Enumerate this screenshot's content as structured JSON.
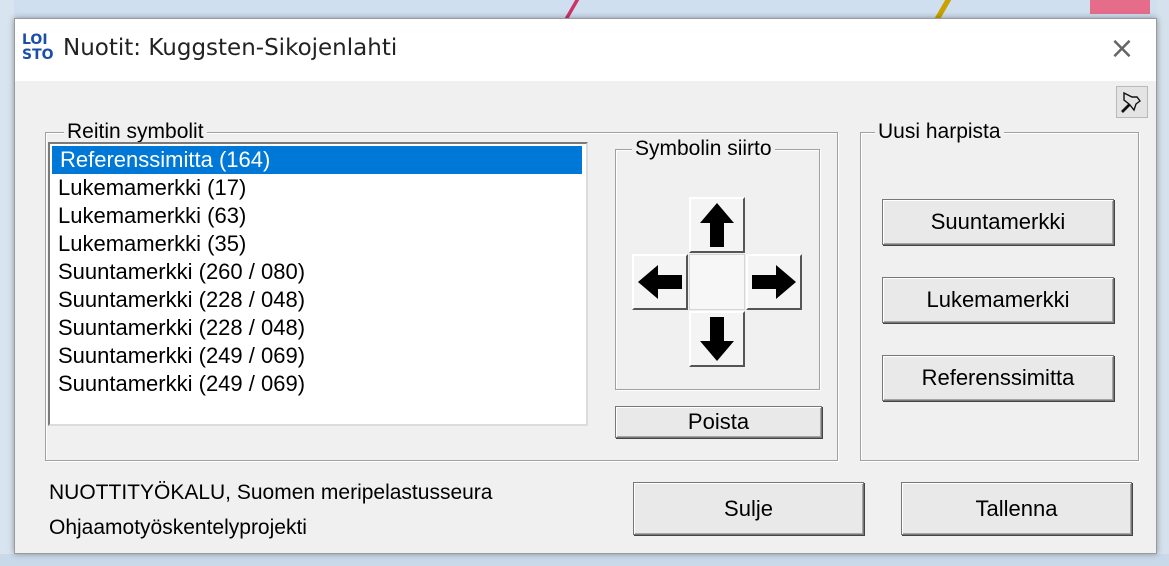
{
  "window": {
    "title": "Nuotit: Kuggsten-Sikojenlahti",
    "logo_top": "LOI",
    "logo_bottom": "STO",
    "close_label": "×"
  },
  "route_symbols": {
    "legend": "Reitin symbolit",
    "items": [
      "Referenssimitta (164)",
      "Lukemamerkki (17)",
      "Lukemamerkki (63)",
      "Lukemamerkki (35)",
      "Suuntamerkki (260 / 080)",
      "Suuntamerkki (228 / 048)",
      "Suuntamerkki (228 / 048)",
      "Suuntamerkki (249 / 069)",
      "Suuntamerkki (249 / 069)"
    ],
    "selected_index": 0
  },
  "symbol_move": {
    "legend": "Symbolin siirto",
    "delete_label": "Poista"
  },
  "new_chart": {
    "legend": "Uusi harpista",
    "buttons": [
      "Suuntamerkki",
      "Lukemamerkki",
      "Referenssimitta"
    ]
  },
  "footer": {
    "line1": "NUOTTITYÖKALU, Suomen meripelastusseura",
    "line2": "Ohjaamotyöskentelyprojekti",
    "close_label": "Sulje",
    "save_label": "Tallenna"
  },
  "colors": {
    "selection": "#0078d7",
    "logo": "#1a4fa8",
    "dialog_bg": "#f0f0f0"
  }
}
